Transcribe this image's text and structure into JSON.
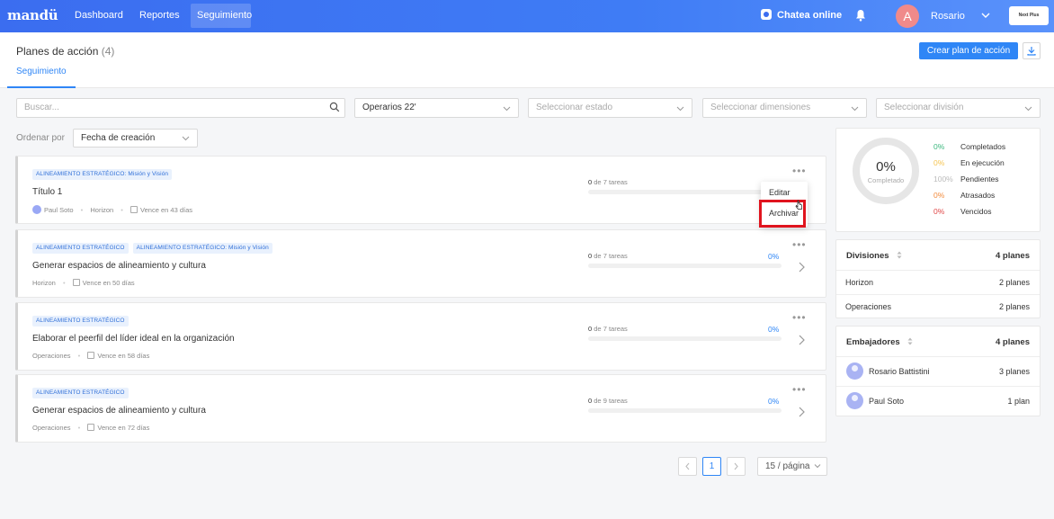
{
  "topbar": {
    "logo": "mandü",
    "nav": [
      "Dashboard",
      "Reportes",
      "Seguimiento"
    ],
    "active_nav": "Seguimiento",
    "chat_label": "Chatea online",
    "user_initial": "A",
    "user_name": "Rosario",
    "next_button": "Next Plus"
  },
  "header": {
    "title": "Planes de acción",
    "count": "(4)",
    "create_button": "Crear plan de acción",
    "tab": "Seguimiento"
  },
  "filters": {
    "search_placeholder": "Buscar...",
    "period": "Operarios 22'",
    "state_placeholder": "Seleccionar estado",
    "dimensions_placeholder": "Seleccionar dimensiones",
    "division_placeholder": "Seleccionar división",
    "sort_label": "Ordenar por",
    "sort_value": "Fecha de creación"
  },
  "plans": [
    {
      "tags": [
        "ALINEAMIENTO ESTRATÉGICO: Misión y Visión"
      ],
      "title": "Título 1",
      "owner": "Paul Soto",
      "division": "Horizon",
      "due": "Vence en 43 días",
      "tasks_done": "0",
      "tasks_total": "de 7 tareas",
      "percent": ""
    },
    {
      "tags": [
        "ALINEAMIENTO ESTRATÉGICO",
        "ALINEAMIENTO ESTRATÉGICO: Misión y Visión"
      ],
      "title": "Generar espacios de alineamiento y cultura",
      "division": "Horizon",
      "due": "Vence en 50 días",
      "tasks_done": "0",
      "tasks_total": "de 7 tareas",
      "percent": "0%"
    },
    {
      "tags": [
        "ALINEAMIENTO ESTRATÉGICO"
      ],
      "title": "Elaborar el peerfil del líder ideal en la organización",
      "division": "Operaciones",
      "due": "Vence en 58 días",
      "tasks_done": "0",
      "tasks_total": "de 7 tareas",
      "percent": "0%"
    },
    {
      "tags": [
        "ALINEAMIENTO ESTRATÉGICO"
      ],
      "title": "Generar espacios de alineamiento y cultura",
      "division": "Operaciones",
      "due": "Vence en 72 días",
      "tasks_done": "0",
      "tasks_total": "de 9 tareas",
      "percent": "0%"
    }
  ],
  "menu": {
    "edit": "Editar",
    "archive": "Archivar"
  },
  "summary": {
    "percent": "0%",
    "label": "Completado",
    "stats": [
      {
        "value": "0%",
        "label": "Completados",
        "color": "#3bb77e"
      },
      {
        "value": "0%",
        "label": "En ejecución",
        "color": "#f5c451"
      },
      {
        "value": "100%",
        "label": "Pendientes",
        "color": "#bbbbbb"
      },
      {
        "value": "0%",
        "label": "Atrasados",
        "color": "#f28b3c"
      },
      {
        "value": "0%",
        "label": "Vencidos",
        "color": "#e04848"
      }
    ]
  },
  "divisions": {
    "title": "Divisiones",
    "count": "4 planes",
    "rows": [
      {
        "label": "Horizon",
        "value": "2 planes"
      },
      {
        "label": "Operaciones",
        "value": "2 planes"
      }
    ]
  },
  "ambassadors": {
    "title": "Embajadores",
    "count": "4 planes",
    "rows": [
      {
        "label": "Rosario Battistini",
        "value": "3 planes"
      },
      {
        "label": "Paul Soto",
        "value": "1 plan"
      }
    ]
  },
  "pagination": {
    "current": "1",
    "page_size": "15 / página"
  }
}
